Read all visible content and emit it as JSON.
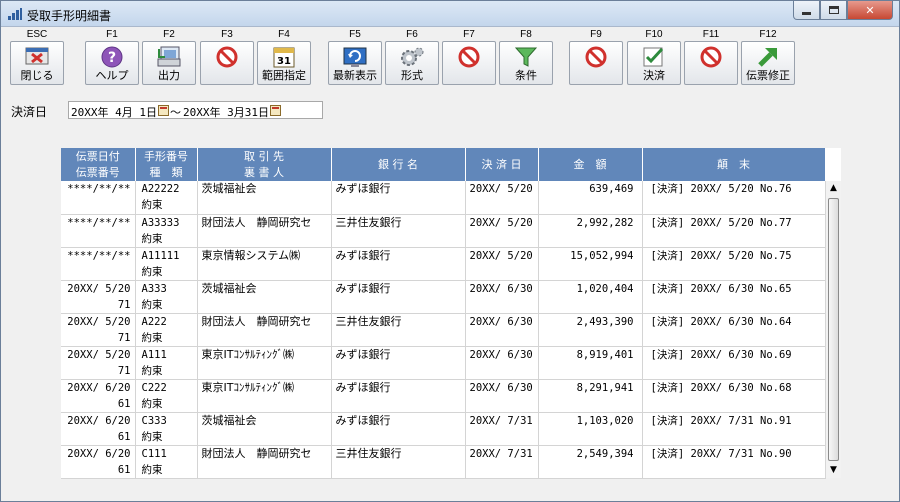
{
  "window": {
    "title": "受取手形明細書"
  },
  "toolbar": [
    {
      "key": "ESC",
      "label": "閉じる",
      "icon": "close-icon"
    },
    {
      "key": "F1",
      "label": "ヘルプ",
      "icon": "help-icon"
    },
    {
      "key": "F2",
      "label": "出力",
      "icon": "output-icon"
    },
    {
      "key": "F3",
      "label": "",
      "icon": "disabled-icon"
    },
    {
      "key": "F4",
      "label": "範囲指定",
      "icon": "calendar-icon"
    },
    {
      "key": "F5",
      "label": "最新表示",
      "icon": "refresh-icon"
    },
    {
      "key": "F6",
      "label": "形式",
      "icon": "gear-icon"
    },
    {
      "key": "F7",
      "label": "",
      "icon": "disabled-icon"
    },
    {
      "key": "F8",
      "label": "条件",
      "icon": "filter-icon"
    },
    {
      "key": "F9",
      "label": "",
      "icon": "disabled-icon"
    },
    {
      "key": "F10",
      "label": "決済",
      "icon": "checkmark-icon"
    },
    {
      "key": "F11",
      "label": "",
      "icon": "disabled-icon"
    },
    {
      "key": "F12",
      "label": "伝票修正",
      "icon": "arrow-up-right-icon"
    }
  ],
  "filter": {
    "label": "決済日",
    "from": "20XX年 4月 1日",
    "sep": "～",
    "to": "20XX年 3月31日"
  },
  "table": {
    "headers": [
      [
        "伝票日付",
        "伝票番号"
      ],
      [
        "手形番号",
        "種　類"
      ],
      [
        "取 引 先",
        "裏 書 人"
      ],
      [
        "銀 行 名",
        ""
      ],
      [
        "決 済 日",
        ""
      ],
      [
        "金　額",
        ""
      ],
      [
        "顛　末",
        ""
      ]
    ],
    "rows": [
      {
        "date": "****/**/**",
        "slip": "",
        "no": "A22222",
        "kind": "約束",
        "partner": "茨城福祉会",
        "bank": "みずほ銀行",
        "kdate": "20XX/ 5/20",
        "amount": "639,469",
        "desc": "[決済] 20XX/ 5/20 No.76"
      },
      {
        "date": "****/**/**",
        "slip": "",
        "no": "A33333",
        "kind": "約束",
        "partner": "財団法人　静岡研究セ",
        "bank": "三井住友銀行",
        "kdate": "20XX/ 5/20",
        "amount": "2,992,282",
        "desc": "[決済] 20XX/ 5/20 No.77"
      },
      {
        "date": "****/**/**",
        "slip": "",
        "no": "A11111",
        "kind": "約束",
        "partner": "東京情報システム㈱",
        "bank": "みずほ銀行",
        "kdate": "20XX/ 5/20",
        "amount": "15,052,994",
        "desc": "[決済] 20XX/ 5/20 No.75"
      },
      {
        "date": "20XX/ 5/20",
        "slip": "71",
        "no": "A333",
        "kind": "約束",
        "partner": "茨城福祉会",
        "bank": "みずほ銀行",
        "kdate": "20XX/ 6/30",
        "amount": "1,020,404",
        "desc": "[決済] 20XX/ 6/30 No.65"
      },
      {
        "date": "20XX/ 5/20",
        "slip": "71",
        "no": "A222",
        "kind": "約束",
        "partner": "財団法人　静岡研究セ",
        "bank": "三井住友銀行",
        "kdate": "20XX/ 6/30",
        "amount": "2,493,390",
        "desc": "[決済] 20XX/ 6/30 No.64"
      },
      {
        "date": "20XX/ 5/20",
        "slip": "71",
        "no": "A111",
        "kind": "約束",
        "partner": "東京ITｺﾝｻﾙﾃｨﾝｸﾞ㈱",
        "bank": "みずほ銀行",
        "kdate": "20XX/ 6/30",
        "amount": "8,919,401",
        "desc": "[決済] 20XX/ 6/30 No.69"
      },
      {
        "date": "20XX/ 6/20",
        "slip": "61",
        "no": "C222",
        "kind": "約束",
        "partner": "東京ITｺﾝｻﾙﾃｨﾝｸﾞ㈱",
        "bank": "みずほ銀行",
        "kdate": "20XX/ 6/30",
        "amount": "8,291,941",
        "desc": "[決済] 20XX/ 6/30 No.68"
      },
      {
        "date": "20XX/ 6/20",
        "slip": "61",
        "no": "C333",
        "kind": "約束",
        "partner": "茨城福祉会",
        "bank": "みずほ銀行",
        "kdate": "20XX/ 7/31",
        "amount": "1,103,020",
        "desc": "[決済] 20XX/ 7/31 No.91"
      },
      {
        "date": "20XX/ 6/20",
        "slip": "61",
        "no": "C111",
        "kind": "約束",
        "partner": "財団法人　静岡研究セ",
        "bank": "三井住友銀行",
        "kdate": "20XX/ 7/31",
        "amount": "2,549,394",
        "desc": "[決済] 20XX/ 7/31 No.90"
      }
    ]
  },
  "colors": {
    "header_bg": "#6187ba",
    "accent_red": "#c0392b",
    "accent_green": "#3a9a3a"
  }
}
